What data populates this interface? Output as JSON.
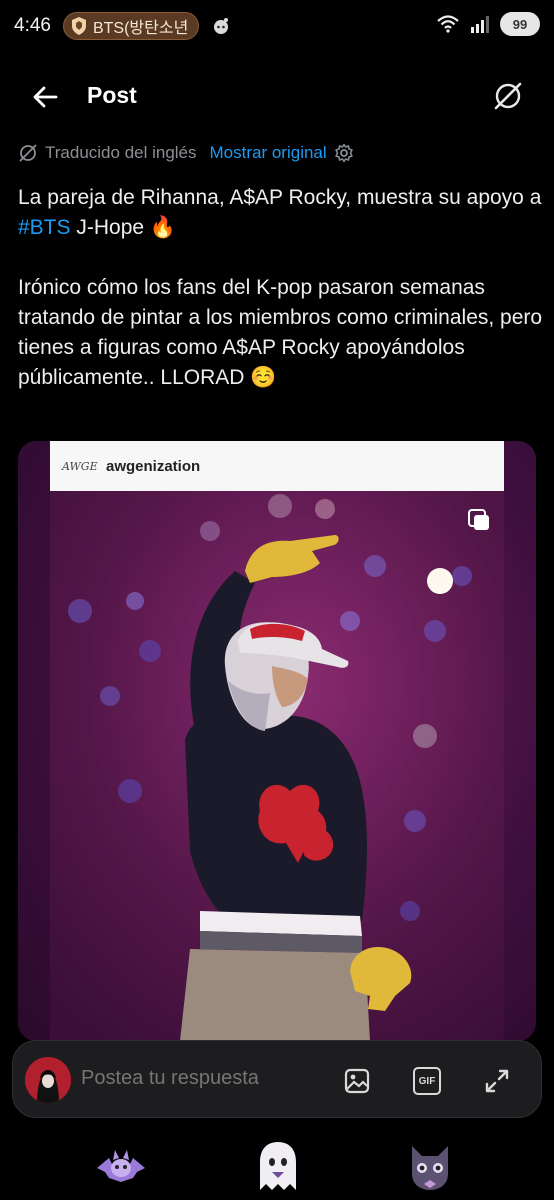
{
  "status": {
    "time": "4:46",
    "notification_chip": "BTS(방탄소년",
    "battery": "99",
    "icons": [
      "brand-shield-icon",
      "reddit-icon",
      "wifi-icon",
      "signal-icon",
      "battery-icon"
    ]
  },
  "header": {
    "title": "Post",
    "back_icon": "back-arrow-icon",
    "grok_icon": "grok-icon"
  },
  "translation": {
    "label": "Traducido del inglés",
    "link": "Mostrar original"
  },
  "post": {
    "line1_before": "La pareja de Rihanna, A$AP Rocky, muestra su apoyo a ",
    "hashtag": "#BTS",
    "line1_after": " J-Hope 🔥",
    "paragraph2": "Irónico cómo los fans del K-pop pasaron semanas tratando de pintar a los miembros como criminales, pero tienes a figuras como A$AP Rocky apoyándolos públicamente.. LLORAD ☺️"
  },
  "media": {
    "ig_logo": "AWGE",
    "ig_user": "awgenization",
    "cap_text": "AWGE"
  },
  "reply": {
    "placeholder": "Postea tu respuesta",
    "gif_label": "GIF",
    "icons": [
      "image-icon",
      "gif-icon",
      "expand-icon"
    ]
  },
  "nav": {
    "icons": [
      "bat-cat-icon",
      "ghost-icon",
      "cat-icon"
    ]
  },
  "colors": {
    "accent": "#1d9bf0",
    "background": "#000000",
    "muted": "#8b8f94"
  }
}
